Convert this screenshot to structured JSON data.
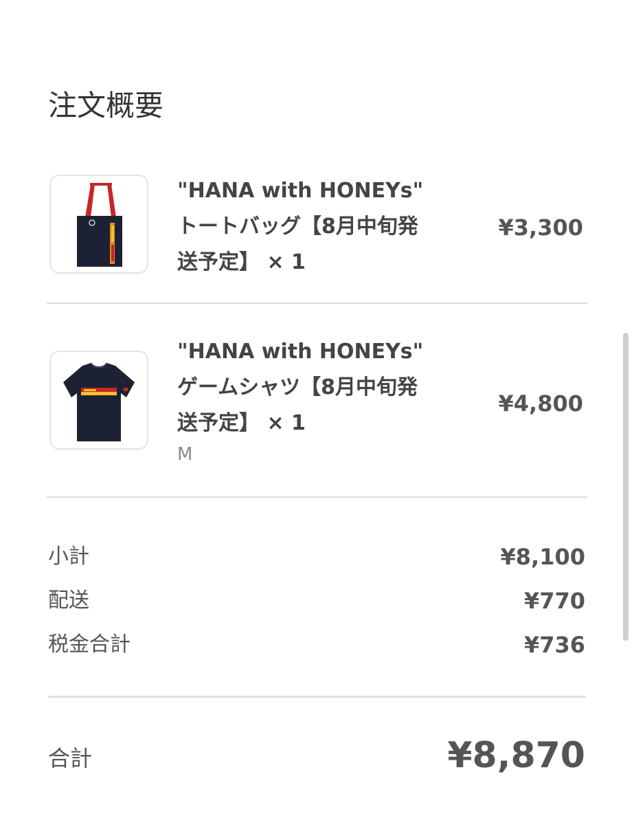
{
  "order_summary": {
    "title": "注文概要",
    "items": [
      {
        "name": "\"HANA with HONEYs\"\nトートバッグ【8月中旬発\n送予定】 × 1",
        "variant": "",
        "price": "¥3,300",
        "thumbnail_icon": "tote-bag-image"
      },
      {
        "name": "\"HANA with HONEYs\"\nゲームシャツ【8月中旬発\n送予定】 × 1",
        "variant": "M",
        "price": "¥4,800",
        "thumbnail_icon": "game-shirt-image"
      }
    ],
    "subtotal": {
      "label": "小計",
      "value": "¥8,100"
    },
    "shipping": {
      "label": "配送",
      "value": "¥770"
    },
    "tax": {
      "label": "税金合計",
      "value": "¥736"
    },
    "total": {
      "label": "合計",
      "value": "¥8,870"
    }
  },
  "colors": {
    "text": "#333333",
    "muted": "#8a8a8a",
    "divider": "#dcdcdc",
    "product_navy": "#1c2233",
    "strap_red": "#c8262a",
    "print_yellow": "#f2c12e"
  }
}
